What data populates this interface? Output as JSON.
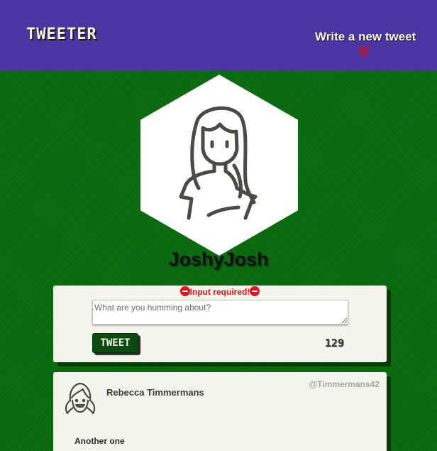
{
  "header": {
    "brand": "TWEETER",
    "compose_link": "Write a new tweet",
    "compose_icon": "double-chevron-down-icon"
  },
  "profile": {
    "avatar_icon": "woman-avatar-icon",
    "username": "JoshyJosh"
  },
  "compose": {
    "error_text": "Input required!",
    "error_icon": "no-entry-icon",
    "placeholder": "What are you humming about?",
    "value": "",
    "button_label": "TWEET",
    "char_counter": "129"
  },
  "tweets": [
    {
      "avatar_icon": "girl-avatar-icon",
      "name": "Rebecca Timmermans",
      "handle": "@Timmermans42",
      "content": "Another one"
    }
  ],
  "colors": {
    "header_bg": "#4a35a3",
    "page_bg": "#0a6a10",
    "card_bg": "#f4f3ec",
    "button_bg": "#0c4a12",
    "error": "#e3131b",
    "chevron": "#c0131a"
  }
}
